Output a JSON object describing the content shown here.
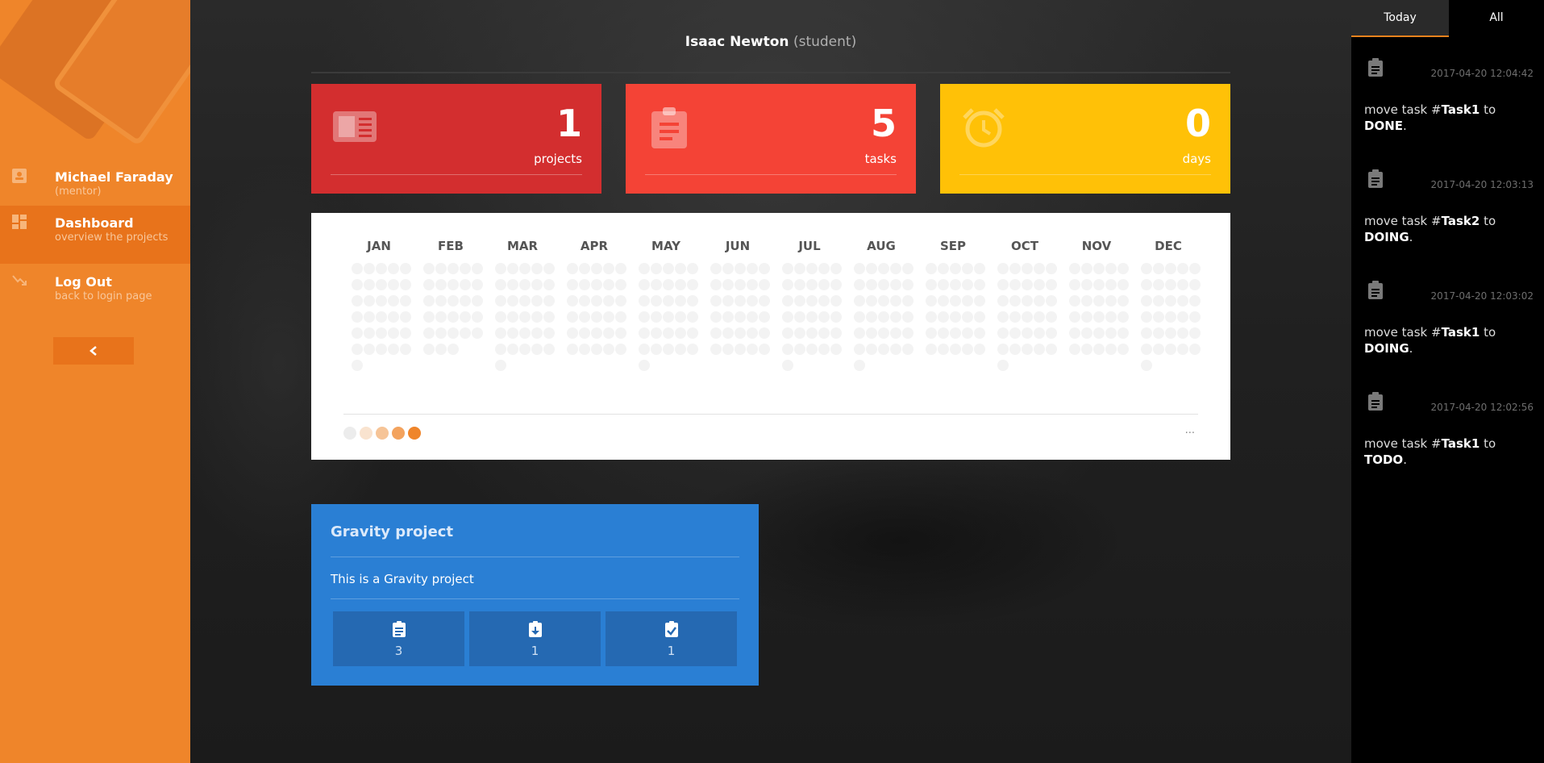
{
  "sidebar": {
    "user": {
      "name": "Michael Faraday",
      "role": "(mentor)"
    },
    "dashboard": {
      "title": "Dashboard",
      "subtitle": "overview the projects"
    },
    "logout": {
      "title": "Log Out",
      "subtitle": "back to login page"
    },
    "collapse_glyph": "‹"
  },
  "header": {
    "name": "Isaac Newton",
    "role": "(student)"
  },
  "stats": [
    {
      "value": "1",
      "label": "projects",
      "color": "#d32e2f",
      "icon": "project-icon"
    },
    {
      "value": "5",
      "label": "tasks",
      "color": "#f44336",
      "icon": "clipboard-icon"
    },
    {
      "value": "0",
      "label": "days",
      "color": "#ffc107",
      "icon": "alarm-icon"
    }
  ],
  "heatmap": {
    "months": [
      "JAN",
      "FEB",
      "MAR",
      "APR",
      "MAY",
      "JUN",
      "JUL",
      "AUG",
      "SEP",
      "OCT",
      "NOV",
      "DEC"
    ],
    "legend_colors": [
      "#ececec",
      "#f9e3cf",
      "#f6c497",
      "#f3a35e",
      "#ef852a"
    ],
    "empty_color": "#f3f3f3",
    "more_label": "..."
  },
  "project": {
    "title": "Gravity project",
    "description": "This is a Gravity project",
    "stats": [
      {
        "icon": "clipboard-list-icon",
        "value": "3"
      },
      {
        "icon": "clipboard-download-icon",
        "value": "1"
      },
      {
        "icon": "clipboard-check-icon",
        "value": "1"
      }
    ]
  },
  "activity": {
    "tabs": {
      "today": "Today",
      "all": "All"
    },
    "entries": [
      {
        "time": "2017-04-20 12:04:42",
        "prefix": "move task #",
        "task": "Task1",
        "mid": " to ",
        "status": "DONE",
        "suffix": "."
      },
      {
        "time": "2017-04-20 12:03:13",
        "prefix": "move task #",
        "task": "Task2",
        "mid": " to ",
        "status": "DOING",
        "suffix": "."
      },
      {
        "time": "2017-04-20 12:03:02",
        "prefix": "move task #",
        "task": "Task1",
        "mid": " to ",
        "status": "DOING",
        "suffix": "."
      },
      {
        "time": "2017-04-20 12:02:56",
        "prefix": "move task #",
        "task": "Task1",
        "mid": " to ",
        "status": "TODO",
        "suffix": "."
      }
    ]
  }
}
